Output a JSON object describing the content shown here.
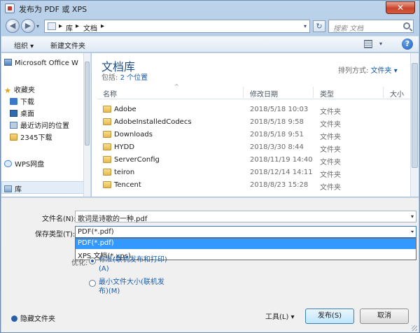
{
  "window": {
    "title": "发布为 PDF 或 XPS",
    "close_glyph": "✕"
  },
  "nav": {
    "back_glyph": "◀",
    "forward_glyph": "▶",
    "breadcrumb": [
      "库",
      "文档"
    ],
    "separator": "▸",
    "search_placeholder": "搜索 文档",
    "refresh_glyph": "↻"
  },
  "toolbar": {
    "organize": "组织 ▾",
    "new_folder": "新建文件夹",
    "help": "?"
  },
  "sidebar": {
    "items": [
      {
        "label": "Microsoft Office W",
        "icon": "monitor-icon"
      },
      {
        "label": "收藏夹",
        "icon": "star-icon"
      },
      {
        "label": "下载",
        "icon": "download-icon"
      },
      {
        "label": "桌面",
        "icon": "desktop-icon"
      },
      {
        "label": "最近访问的位置",
        "icon": "recent-icon"
      },
      {
        "label": "2345下载",
        "icon": "folder-icon"
      },
      {
        "label": "WPS网盘",
        "icon": "cloud-icon"
      },
      {
        "label": "库",
        "icon": "library-icon"
      }
    ]
  },
  "main": {
    "library_title": "文档库",
    "includes_label": "包括:",
    "includes_link": "2 个位置",
    "arrange_label": "排列方式:",
    "arrange_value": "文件夹 ▾",
    "columns": {
      "name": "名称",
      "modified": "修改日期",
      "type": "类型",
      "size": "大小"
    },
    "files": [
      {
        "name": "Adobe",
        "date": "2018/5/18 10:03",
        "type": "文件夹"
      },
      {
        "name": "AdobeInstalledCodecs",
        "date": "2018/5/18 9:58",
        "type": "文件夹"
      },
      {
        "name": "Downloads",
        "date": "2018/5/18 9:51",
        "type": "文件夹"
      },
      {
        "name": "HYDD",
        "date": "2018/3/30 8:44",
        "type": "文件夹"
      },
      {
        "name": "ServerConfig",
        "date": "2018/11/19 14:40",
        "type": "文件夹"
      },
      {
        "name": "teiron",
        "date": "2018/12/14 14:11",
        "type": "文件夹"
      },
      {
        "name": "Tencent",
        "date": "2018/8/23 15:28",
        "type": "文件夹"
      }
    ]
  },
  "form": {
    "filename_label": "文件名(N):",
    "filename_value": "歌词是诗歌的一种.pdf",
    "savetype_label": "保存类型(T):",
    "savetype_value": "PDF(*.pdf)",
    "savetype_options": [
      "PDF(*.pdf)",
      "XPS 文档(*.xps)"
    ],
    "optimize_label": "优化:",
    "radio_standard": "标准(联机发布和打印)",
    "radio_standard_key": "(A)",
    "radio_min": "最小文件大小(联机发",
    "radio_min_2": "布)(M)",
    "hide_folders": "隐藏文件夹"
  },
  "buttons": {
    "tools": "工具(L)   ▾",
    "publish": "发布(S)",
    "cancel": "取消"
  }
}
